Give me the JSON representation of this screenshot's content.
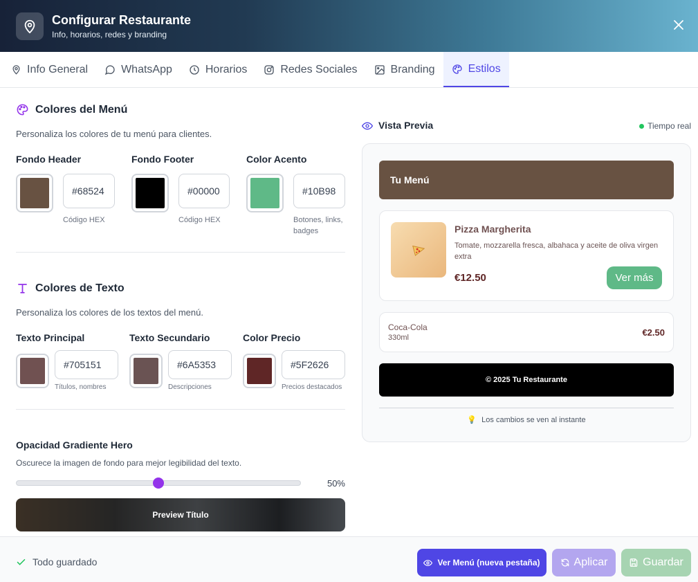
{
  "header": {
    "title": "Configurar Restaurante",
    "subtitle": "Info, horarios, redes y branding",
    "icon": "map-pin-icon",
    "close_icon": "close-icon"
  },
  "tabs": [
    {
      "label": "Info General",
      "icon": "map-pin-icon"
    },
    {
      "label": "WhatsApp",
      "icon": "chat-bubble-icon"
    },
    {
      "label": "Horarios",
      "icon": "clock-icon"
    },
    {
      "label": "Redes Sociales",
      "icon": "instagram-icon"
    },
    {
      "label": "Branding",
      "icon": "image-icon"
    },
    {
      "label": "Estilos",
      "icon": "palette-icon",
      "active": true
    }
  ],
  "menu_colors": {
    "title": "Colores del Menú",
    "description": "Personaliza los colores de tu menú para clientes.",
    "fields": [
      {
        "label": "Fondo Header",
        "value": "#68524",
        "color": "#685242",
        "hint": "Código HEX"
      },
      {
        "label": "Fondo Footer",
        "value": "#00000",
        "color": "#000000",
        "hint": "Código HEX"
      },
      {
        "label": "Color Acento",
        "value": "#10B98",
        "color": "#5FB987",
        "hint": "Botones, links, badges"
      }
    ]
  },
  "text_colors": {
    "title": "Colores de Texto",
    "description": "Personaliza los colores de los textos del menú.",
    "fields": [
      {
        "label": "Texto Principal",
        "value": "#705151",
        "color": "#705151",
        "hint": "Títulos, nombres"
      },
      {
        "label": "Texto Secundario",
        "value": "#6A5353",
        "color": "#6A5353",
        "hint": "Descripciones"
      },
      {
        "label": "Color Precio",
        "value": "#5F2626",
        "color": "#5F2626",
        "hint": "Precios destacados"
      }
    ]
  },
  "hero_opacity": {
    "label": "Opacidad Gradiente Hero",
    "description": "Oscurece la imagen de fondo para mejor legibilidad del texto.",
    "value": 0.5,
    "value_label": "50%",
    "preview_title": "Preview Título"
  },
  "preview": {
    "title": "Vista Previa",
    "status": "Tiempo real",
    "status_color": "#22c55e",
    "menu_header": "Tu Menú",
    "item1": {
      "name": "Pizza Margherita",
      "description": "Tomate, mozzarella fresca, albahaca y aceite de oliva virgen extra",
      "price": "€12.50",
      "button": "Ver más",
      "icon": "pizza-icon"
    },
    "item2": {
      "name": "Coca-Cola",
      "detail": "330ml",
      "price": "€2.50"
    },
    "footer_text": "© 2025 Tu Restaurante",
    "note": "Los cambios se ven al instante",
    "note_icon": "lightbulb-icon"
  },
  "footer": {
    "status": "Todo guardado",
    "view_menu": "Ver Menú (nueva pestaña)",
    "apply": "Aplicar",
    "save": "Guardar"
  },
  "colors": {
    "accent": "#4f46e5",
    "purple": "#9333ea"
  }
}
